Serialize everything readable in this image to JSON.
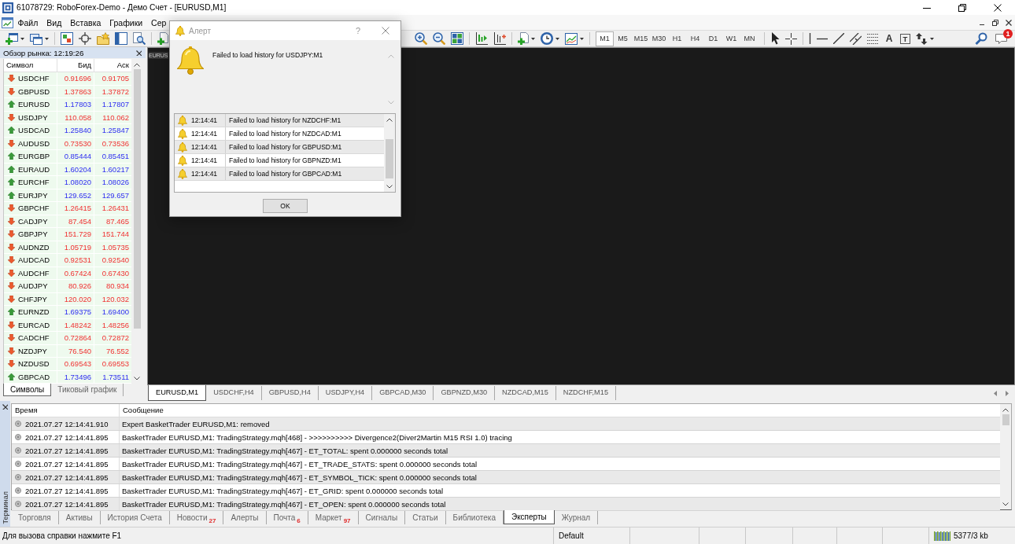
{
  "window": {
    "title": "61078729: RoboForex-Demo - Демо Счет - [EURUSD,M1]"
  },
  "menu": [
    "Файл",
    "Вид",
    "Вставка",
    "Графики",
    "Сер"
  ],
  "toolbar": {
    "timeframes": [
      {
        "label": "M1",
        "selected": true
      },
      {
        "label": "M5",
        "selected": false
      },
      {
        "label": "M15",
        "selected": false
      },
      {
        "label": "M30",
        "selected": false
      },
      {
        "label": "H1",
        "selected": false
      },
      {
        "label": "H4",
        "selected": false
      },
      {
        "label": "D1",
        "selected": false
      },
      {
        "label": "W1",
        "selected": false
      },
      {
        "label": "MN",
        "selected": false
      }
    ],
    "text_tool": "A",
    "label_tool": "T",
    "notification_count": "1"
  },
  "market_watch": {
    "title": "Обзор рынка: 12:19:26",
    "columns": [
      "Символ",
      "Бид",
      "Аск"
    ],
    "rows": [
      {
        "symbol": "USDCHF",
        "bid": "0.91696",
        "ask": "0.91705",
        "rising": false
      },
      {
        "symbol": "GBPUSD",
        "bid": "1.37863",
        "ask": "1.37872",
        "rising": false
      },
      {
        "symbol": "EURUSD",
        "bid": "1.17803",
        "ask": "1.17807",
        "rising": true
      },
      {
        "symbol": "USDJPY",
        "bid": "110.058",
        "ask": "110.062",
        "rising": false
      },
      {
        "symbol": "USDCAD",
        "bid": "1.25840",
        "ask": "1.25847",
        "rising": true
      },
      {
        "symbol": "AUDUSD",
        "bid": "0.73530",
        "ask": "0.73536",
        "rising": false
      },
      {
        "symbol": "EURGBP",
        "bid": "0.85444",
        "ask": "0.85451",
        "rising": true
      },
      {
        "symbol": "EURAUD",
        "bid": "1.60204",
        "ask": "1.60217",
        "rising": true
      },
      {
        "symbol": "EURCHF",
        "bid": "1.08020",
        "ask": "1.08026",
        "rising": true
      },
      {
        "symbol": "EURJPY",
        "bid": "129.652",
        "ask": "129.657",
        "rising": true
      },
      {
        "symbol": "GBPCHF",
        "bid": "1.26415",
        "ask": "1.26431",
        "rising": false
      },
      {
        "symbol": "CADJPY",
        "bid": "87.454",
        "ask": "87.465",
        "rising": false
      },
      {
        "symbol": "GBPJPY",
        "bid": "151.729",
        "ask": "151.744",
        "rising": false
      },
      {
        "symbol": "AUDNZD",
        "bid": "1.05719",
        "ask": "1.05735",
        "rising": false
      },
      {
        "symbol": "AUDCAD",
        "bid": "0.92531",
        "ask": "0.92540",
        "rising": false
      },
      {
        "symbol": "AUDCHF",
        "bid": "0.67424",
        "ask": "0.67430",
        "rising": false
      },
      {
        "symbol": "AUDJPY",
        "bid": "80.926",
        "ask": "80.934",
        "rising": false
      },
      {
        "symbol": "CHFJPY",
        "bid": "120.020",
        "ask": "120.032",
        "rising": false
      },
      {
        "symbol": "EURNZD",
        "bid": "1.69375",
        "ask": "1.69400",
        "rising": true
      },
      {
        "symbol": "EURCAD",
        "bid": "1.48242",
        "ask": "1.48256",
        "rising": false
      },
      {
        "symbol": "CADCHF",
        "bid": "0.72864",
        "ask": "0.72872",
        "rising": false
      },
      {
        "symbol": "NZDJPY",
        "bid": "76.540",
        "ask": "76.552",
        "rising": false
      },
      {
        "symbol": "NZDUSD",
        "bid": "0.69543",
        "ask": "0.69553",
        "rising": false
      },
      {
        "symbol": "GBPCAD",
        "bid": "1.73496",
        "ask": "1.73511",
        "rising": true
      }
    ],
    "tabs": [
      {
        "label": "Символы",
        "selected": true
      },
      {
        "label": "Тиковый график",
        "selected": false
      }
    ]
  },
  "chart": {
    "label": "EURUS"
  },
  "chart_tabs": [
    {
      "label": "EURUSD,M1",
      "selected": true
    },
    {
      "label": "USDCHF,H4",
      "selected": false
    },
    {
      "label": "GBPUSD,H4",
      "selected": false
    },
    {
      "label": "USDJPY,H4",
      "selected": false
    },
    {
      "label": "GBPCAD,M30",
      "selected": false
    },
    {
      "label": "GBPNZD,M30",
      "selected": false
    },
    {
      "label": "NZDCAD,M15",
      "selected": false
    },
    {
      "label": "NZDCHF,M15",
      "selected": false
    }
  ],
  "alert_dialog": {
    "title": "Алерт",
    "help": "?",
    "message": "Failed to load history for USDJPY:M1",
    "rows": [
      {
        "time": "12:14:41",
        "message": "Failed to load history for NZDCHF:M1"
      },
      {
        "time": "12:14:41",
        "message": "Failed to load history for NZDCAD:M1"
      },
      {
        "time": "12:14:41",
        "message": "Failed to load history for GBPUSD:M1"
      },
      {
        "time": "12:14:41",
        "message": "Failed to load history for GBPNZD:M1"
      },
      {
        "time": "12:14:41",
        "message": "Failed to load history for GBPCAD:M1"
      }
    ],
    "button": "OK"
  },
  "terminal": {
    "title": "Терминал",
    "columns": [
      "Время",
      "Сообщение"
    ],
    "rows": [
      {
        "time": "2021.07.27 12:14:41.910",
        "message": "Expert BasketTrader EURUSD,M1: removed"
      },
      {
        "time": "2021.07.27 12:14:41.895",
        "message": "BasketTrader EURUSD,M1: TradingStrategy.mqh[468] - >>>>>>>>>> Divergence2(Diver2Martin M15 RSI 1.0) tracing"
      },
      {
        "time": "2021.07.27 12:14:41.895",
        "message": "BasketTrader EURUSD,M1: TradingStrategy.mqh[467] - ET_TOTAL: spent 0.000000 seconds total"
      },
      {
        "time": "2021.07.27 12:14:41.895",
        "message": "BasketTrader EURUSD,M1: TradingStrategy.mqh[467] - ET_TRADE_STATS: spent 0.000000 seconds total"
      },
      {
        "time": "2021.07.27 12:14:41.895",
        "message": "BasketTrader EURUSD,M1: TradingStrategy.mqh[467] - ET_SYMBOL_TICK: spent 0.000000 seconds total"
      },
      {
        "time": "2021.07.27 12:14:41.895",
        "message": "BasketTrader EURUSD,M1: TradingStrategy.mqh[467] - ET_GRID: spent 0.000000 seconds total"
      },
      {
        "time": "2021.07.27 12:14:41.895",
        "message": "BasketTrader EURUSD,M1: TradingStrategy.mqh[467] - ET_OPEN: spent 0.000000 seconds total"
      }
    ],
    "tabs": [
      {
        "label": "Торговля",
        "selected": false
      },
      {
        "label": "Активы",
        "selected": false
      },
      {
        "label": "История Счета",
        "selected": false
      },
      {
        "label": "Новости",
        "badge": "27",
        "selected": false
      },
      {
        "label": "Алерты",
        "selected": false
      },
      {
        "label": "Почта",
        "badge": "6",
        "selected": false
      },
      {
        "label": "Маркет",
        "badge": "97",
        "selected": false
      },
      {
        "label": "Сигналы",
        "selected": false
      },
      {
        "label": "Статьи",
        "selected": false
      },
      {
        "label": "Библиотека",
        "selected": false
      },
      {
        "label": "Эксперты",
        "selected": true
      },
      {
        "label": "Журнал",
        "selected": false
      }
    ]
  },
  "status_bar": {
    "help": "Для вызова справки нажмите F1",
    "profile": "Default",
    "traffic": "5377/3 kb"
  }
}
